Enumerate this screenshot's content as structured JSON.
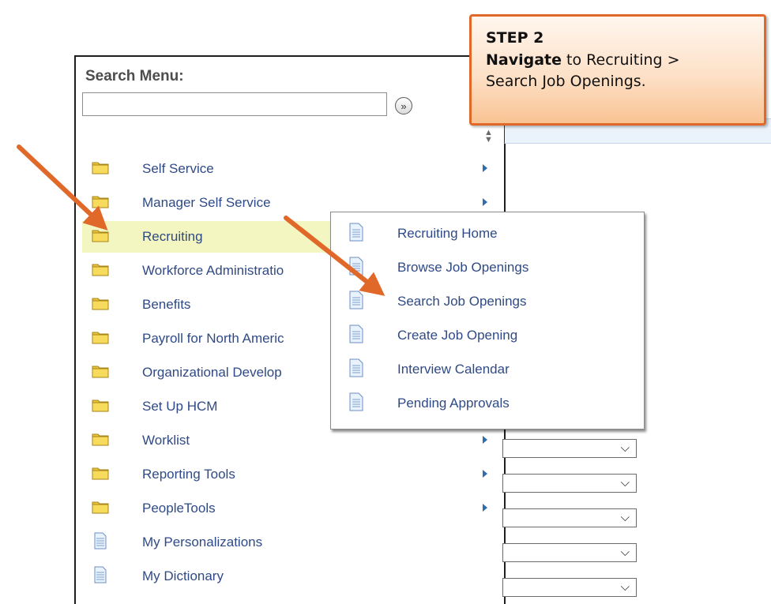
{
  "search": {
    "title": "Search Menu:",
    "input_value": "",
    "go_label": "»"
  },
  "menu": {
    "items": [
      {
        "label": "Self Service",
        "icon": "folder-icon",
        "has_submenu": true
      },
      {
        "label": "Manager Self Service",
        "icon": "folder-icon",
        "has_submenu": true
      },
      {
        "label": "Recruiting",
        "icon": "folder-icon",
        "has_submenu": true,
        "highlighted": true
      },
      {
        "label": "Workforce Administratio",
        "icon": "folder-icon",
        "has_submenu": true
      },
      {
        "label": "Benefits",
        "icon": "folder-icon",
        "has_submenu": true
      },
      {
        "label": "Payroll for North Americ",
        "icon": "folder-icon",
        "has_submenu": true
      },
      {
        "label": "Organizational Develop",
        "icon": "folder-icon",
        "has_submenu": true
      },
      {
        "label": "Set Up HCM",
        "icon": "folder-icon",
        "has_submenu": true
      },
      {
        "label": "Worklist",
        "icon": "folder-icon",
        "has_submenu": true
      },
      {
        "label": "Reporting Tools",
        "icon": "folder-icon",
        "has_submenu": true
      },
      {
        "label": "PeopleTools",
        "icon": "folder-icon",
        "has_submenu": true
      },
      {
        "label": "My Personalizations",
        "icon": "document-icon",
        "has_submenu": false
      },
      {
        "label": "My Dictionary",
        "icon": "document-icon",
        "has_submenu": false
      }
    ]
  },
  "submenu": {
    "items": [
      {
        "label": "Recruiting Home",
        "icon": "document-icon"
      },
      {
        "label": "Browse Job Openings",
        "icon": "document-icon"
      },
      {
        "label": "Search Job Openings",
        "icon": "document-icon"
      },
      {
        "label": "Create Job Opening",
        "icon": "document-icon"
      },
      {
        "label": "Interview Calendar",
        "icon": "document-icon"
      },
      {
        "label": "Pending Approvals",
        "icon": "document-icon"
      }
    ]
  },
  "callout": {
    "step": "STEP 2",
    "bold": "Navigate",
    "line1_rest": " to Recruiting >",
    "line2": "Search Job Openings."
  },
  "colors": {
    "accent_arrow": "#e0692a",
    "link_text": "#2f4a86",
    "highlight_row": "#f4f6c2",
    "callout_border": "#e0692a"
  }
}
